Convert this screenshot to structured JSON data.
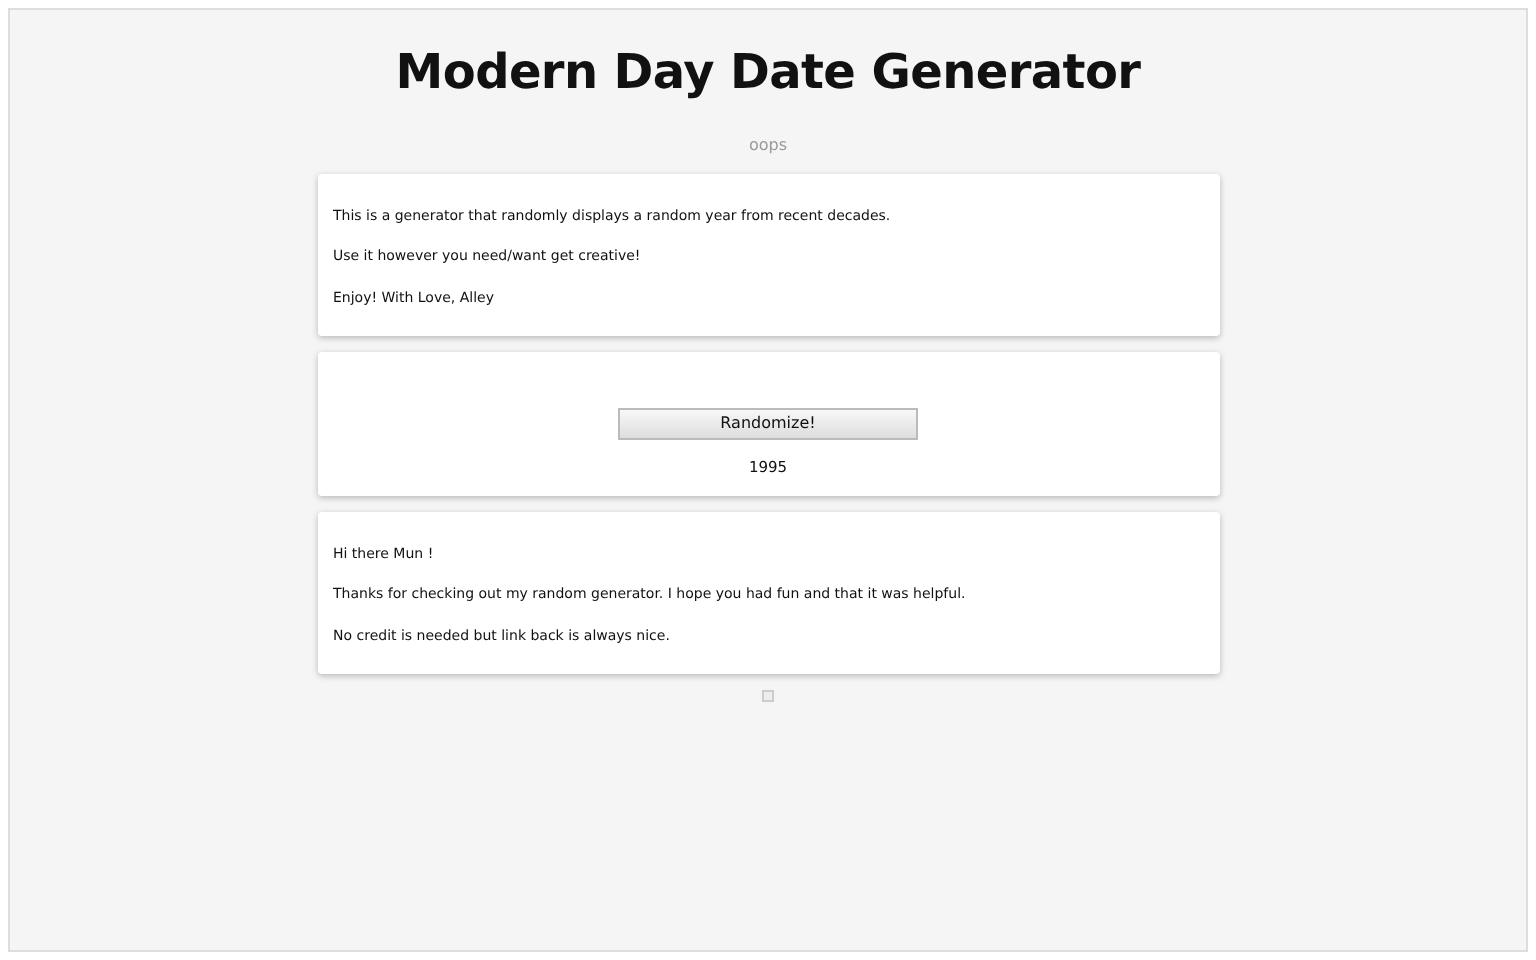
{
  "title": "Modern Day Date Generator",
  "subtitle": "oops",
  "intro": [
    "This is a generator that randomly displays a random year from recent decades.",
    "Use it however you need/want get creative!",
    "Enjoy! With Love, Alley"
  ],
  "generator": {
    "button": "Randomize!",
    "result": "1995"
  },
  "outro": [
    "Hi there Mun !",
    "Thanks for checking out my random generator. I hope you had fun and that it was helpful.",
    "No credit is needed but link back is always nice."
  ]
}
